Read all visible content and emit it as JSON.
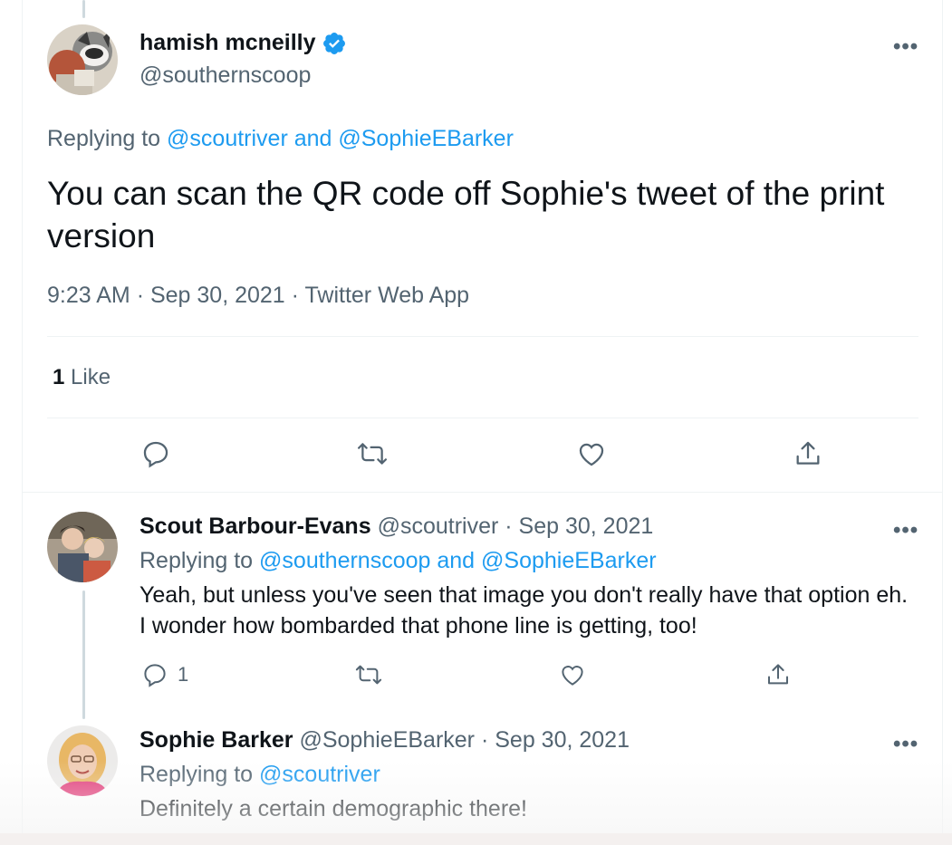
{
  "main_tweet": {
    "author_name": "hamish mcneilly",
    "handle": "@southernscoop",
    "replying_prefix": "Replying to",
    "replying_to": "@scoutriver and @SophieEBarker",
    "text": "You can scan the QR code off Sophie's tweet of the print version",
    "time": "9:23 AM",
    "date": "Sep 30, 2021",
    "source": "Twitter Web App",
    "separator": "·",
    "likes_count": "1",
    "likes_label": "Like",
    "more_icon": "more-icon",
    "verified_icon": "verified-badge-icon"
  },
  "replies": [
    {
      "author_name": "Scout Barbour-Evans",
      "handle": "@scoutriver",
      "separator": "·",
      "date": "Sep 30, 2021",
      "replying_prefix": "Replying to",
      "replying_to": "@southernscoop and @SophieEBarker",
      "text": "Yeah, but unless you've seen that image you don't really have that option eh. I wonder how bombarded that phone line is getting, too!",
      "reply_count": "1"
    },
    {
      "author_name": "Sophie Barker",
      "handle": "@SophieEBarker",
      "separator": "·",
      "date": "Sep 30, 2021",
      "replying_prefix": "Replying to",
      "replying_to": "@scoutriver",
      "text": "Definitely a certain demographic there!"
    }
  ],
  "more_glyph": "•••",
  "icons": [
    "reply-icon",
    "retweet-icon",
    "like-icon",
    "share-icon"
  ],
  "colors": {
    "link": "#1d9bf0",
    "muted": "#536471",
    "text": "#0f1419",
    "divider": "#eff3f4"
  }
}
